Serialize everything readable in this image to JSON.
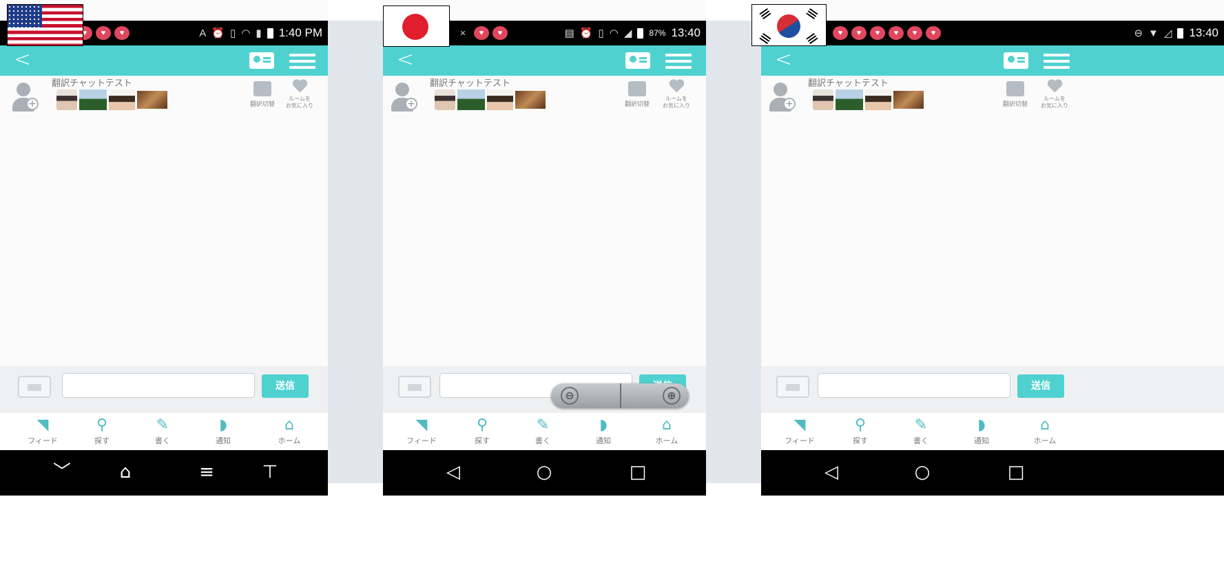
{
  "screens": [
    {
      "id": "us",
      "flag": "US",
      "status": {
        "time": "1:40 PM",
        "battery": "",
        "notif_count": 3
      },
      "room_title": "翻訳チャットテスト",
      "translate_label": "翻訳切替",
      "favorite_label": "ルームを\nお気に入り",
      "send_label": "送信",
      "input_placeholder": "",
      "tabs": [
        "フィード",
        "探す",
        "書く",
        "通知",
        "ホーム"
      ],
      "nav_style": "lg"
    },
    {
      "id": "jp",
      "flag": "JP",
      "status": {
        "time": "13:40",
        "battery": "87%",
        "notif_count": 2
      },
      "room_title": "翻訳チャットテスト",
      "translate_label": "翻訳切替",
      "favorite_label": "ルームを\nお気に入り",
      "send_label": "送信",
      "input_placeholder": "",
      "tabs": [
        "フィード",
        "探す",
        "書く",
        "通知",
        "ホーム"
      ],
      "nav_style": "android"
    },
    {
      "id": "kr",
      "flag": "KR",
      "status": {
        "time": "13:40",
        "battery": "",
        "notif_count": 6
      },
      "room_title": "翻訳チャットテスト",
      "translate_label": "翻訳切替",
      "favorite_label": "ルームを\nお気に入り",
      "send_label": "送信",
      "input_placeholder": "",
      "tabs": [
        "フィード",
        "探す",
        "書く",
        "通知",
        "ホーム"
      ],
      "nav_style": "android"
    }
  ],
  "colors": {
    "accent": "#4fd2cf",
    "gap": "#e1e6ec",
    "status_bar": "#000000",
    "icon_gray": "#b5bcc3"
  },
  "icons": {
    "tabs": [
      "feed-rss-icon",
      "search-icon",
      "pencil-write-icon",
      "bell-notification-icon",
      "home-icon"
    ],
    "lg_nav": [
      "chevron-down-icon",
      "home-outline-icon",
      "menu-icon",
      "notification-drawer-icon"
    ],
    "android_nav": [
      "back-triangle-icon",
      "home-circle-icon",
      "recents-square-icon"
    ]
  },
  "zoom_control": {
    "visible_on": "jp",
    "minus": "⊖",
    "plus": "⊕"
  }
}
